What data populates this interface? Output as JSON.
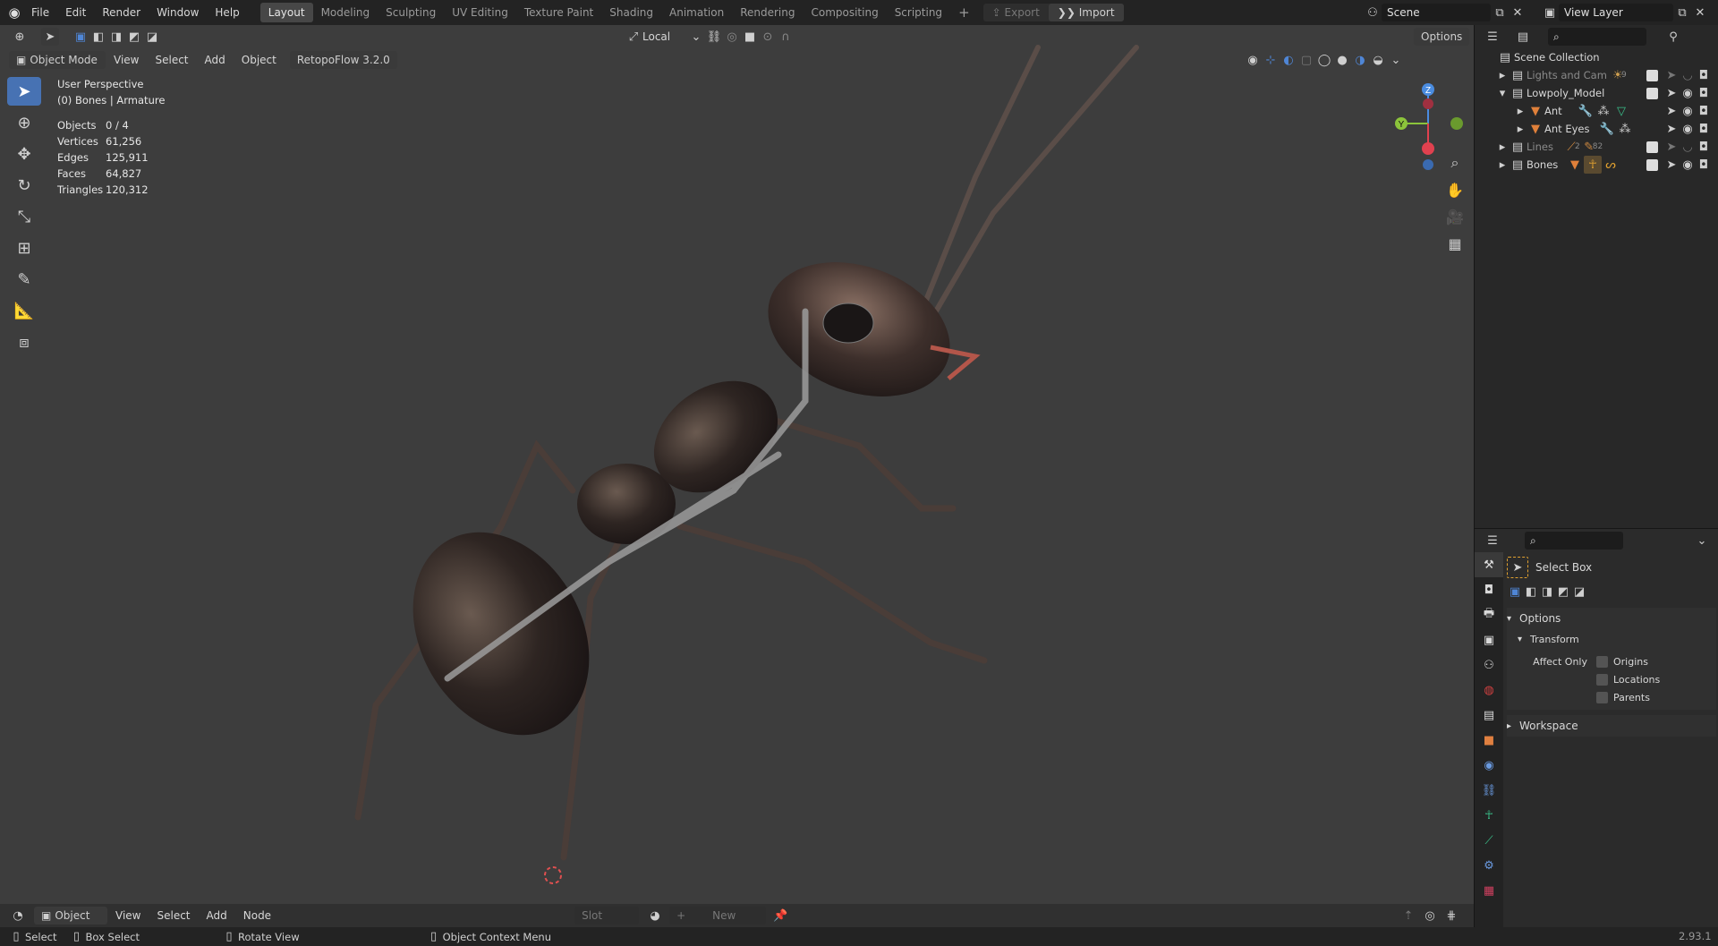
{
  "topbar": {
    "menus": [
      "File",
      "Edit",
      "Render",
      "Window",
      "Help"
    ],
    "workspaces": [
      "Layout",
      "Modeling",
      "Sculpting",
      "UV Editing",
      "Texture Paint",
      "Shading",
      "Animation",
      "Rendering",
      "Compositing",
      "Scripting"
    ],
    "active_workspace": "Layout",
    "plus": "+",
    "export_label": "Export",
    "import_label": "Import",
    "scene_name": "Scene",
    "view_layer": "View Layer"
  },
  "viewport": {
    "header": {
      "transform_orientation": "Local",
      "options_label": "Options",
      "mode": "Object Mode",
      "menus": [
        "View",
        "Select",
        "Add",
        "Object"
      ],
      "addon_menu": "RetopoFlow 3.2.0"
    },
    "overlay": {
      "perspective": "User Perspective",
      "active": "(0) Bones | Armature",
      "stats": [
        {
          "label": "Objects",
          "value": "0 / 4"
        },
        {
          "label": "Vertices",
          "value": "61,256"
        },
        {
          "label": "Edges",
          "value": "125,911"
        },
        {
          "label": "Faces",
          "value": "64,827"
        },
        {
          "label": "Triangles",
          "value": "120,312"
        }
      ]
    },
    "gizmo": {
      "x": "X",
      "y": "Y",
      "z": "Z"
    }
  },
  "outliner": {
    "title": "Scene Collection",
    "rows": [
      {
        "name": "Lights and Cam",
        "badge": "9",
        "dim": true
      },
      {
        "name": "Lowpoly_Model",
        "dim": false
      },
      {
        "name": "Ant",
        "dim": false
      },
      {
        "name": "Ant Eyes",
        "dim": false
      },
      {
        "name": "Lines",
        "badge": "82",
        "badge2": "2",
        "dim": true
      },
      {
        "name": "Bones",
        "dim": false
      }
    ]
  },
  "properties": {
    "tool_name": "Select Box",
    "options_label": "Options",
    "transform_label": "Transform",
    "affect_only_label": "Affect Only",
    "checkboxes": [
      "Origins",
      "Locations",
      "Parents"
    ],
    "workspace_label": "Workspace"
  },
  "bottom_editor": {
    "mode": "Object",
    "menus": [
      "View",
      "Select",
      "Add",
      "Node"
    ],
    "slot": "Slot",
    "new_label": "New"
  },
  "statusbar": {
    "select": "Select",
    "box_select": "Box Select",
    "rotate_view": "Rotate View",
    "context_menu": "Object Context Menu",
    "version": "2.93.1"
  },
  "colors": {
    "accent": "#4772b3",
    "viewport_bg": "#3d3d3d",
    "axis_x": "#e0414f",
    "axis_y": "#8cc43b",
    "axis_z": "#4a8ce0"
  }
}
